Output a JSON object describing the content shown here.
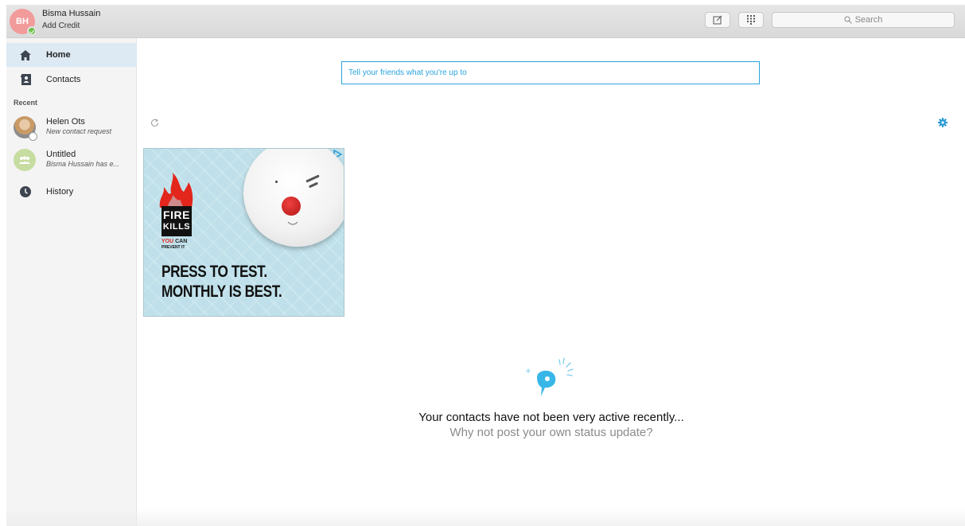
{
  "user": {
    "initials": "BH",
    "name": "Bisma Hussain",
    "credit_link": "Add Credit",
    "avatar_color": "#f29b9b",
    "presence_color": "#6cc24a"
  },
  "toolbar": {
    "compose_icon": "compose-icon",
    "dialpad_icon": "dialpad-icon",
    "search_placeholder": "Search"
  },
  "sidebar": {
    "items": [
      {
        "label": "Home",
        "icon": "home-icon",
        "active": true
      },
      {
        "label": "Contacts",
        "icon": "contacts-icon"
      }
    ],
    "recent_label": "Recent",
    "recent": [
      {
        "title": "Helen Ots",
        "subtitle": "New contact request"
      },
      {
        "title": "Untitled",
        "subtitle": "Bisma Hussain has e..."
      }
    ],
    "history_label": "History"
  },
  "main": {
    "status_placeholder": "Tell your friends what you're up to",
    "accent_color": "#29a3dd",
    "ad": {
      "fire_line1": "FIRE",
      "fire_line2": "KILLS",
      "you": "YOU",
      "can": "CAN",
      "prevent": "PREVENT IT",
      "headline1": "PRESS TO TEST.",
      "headline2": "MONTHLY IS BEST."
    },
    "empty_title": "Your contacts have not been very active recently...",
    "empty_subtitle": "Why not post your own status update?"
  }
}
